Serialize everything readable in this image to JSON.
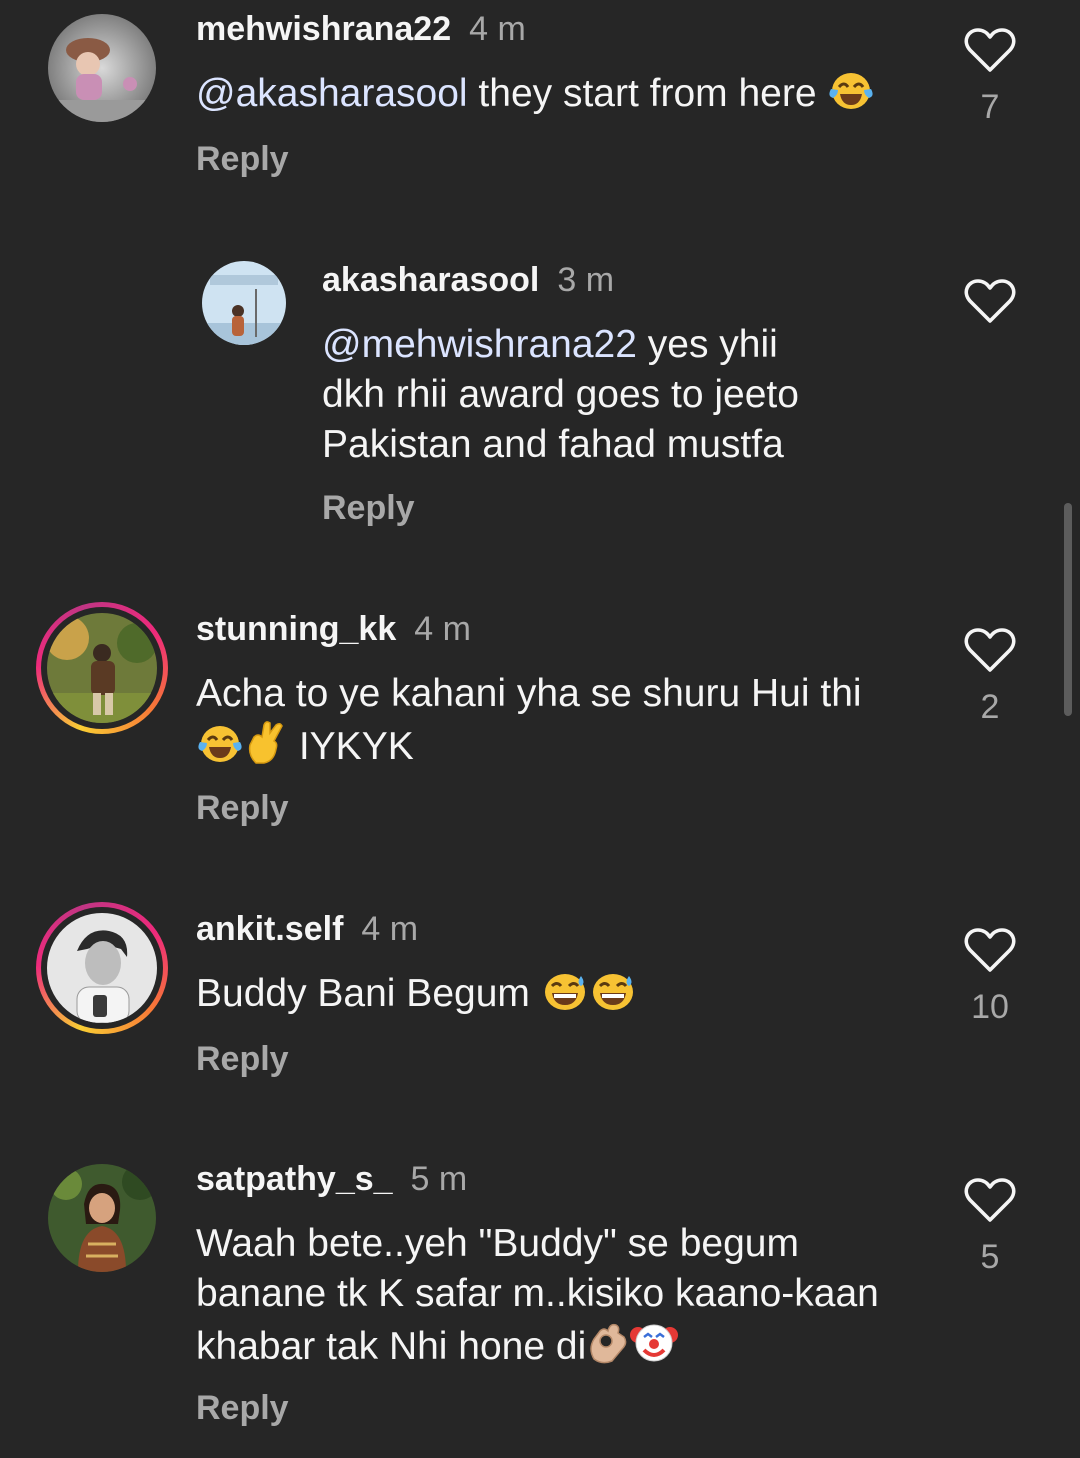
{
  "comments": [
    {
      "username": "mehwishrana22",
      "time": "4 m",
      "mention": "@akasharasool",
      "text": " they start from here ",
      "emojis": [
        "face-with-tears-of-joy"
      ],
      "reply_label": "Reply",
      "likes": "7"
    },
    {
      "username": "akasharasool",
      "time": "3 m",
      "mention": "@mehwishrana22",
      "text_line1": " yes yhii",
      "text_line2": "dkh rhii award goes to jeeto",
      "text_line3": "Pakistan and fahad mustfa",
      "reply_label": "Reply",
      "likes": ""
    },
    {
      "username": "stunning_kk",
      "time": "4 m",
      "text_line1": "Acha to ye kahani yha se shuru Hui thi",
      "text_line2": " IYKYK",
      "emojis": [
        "face-with-tears-of-joy",
        "crossed-fingers"
      ],
      "reply_label": "Reply",
      "likes": "2"
    },
    {
      "username": "ankit.self",
      "time": "4 m",
      "text": "Buddy Bani Begum ",
      "emojis": [
        "grinning-face-with-sweat",
        "grinning-face-with-sweat"
      ],
      "reply_label": "Reply",
      "likes": "10"
    },
    {
      "username": "satpathy_s_",
      "time": "5 m",
      "text_line1": "Waah bete..yeh \"Buddy\" se begum",
      "text_line2": "banane tk K safar m..kisiko kaano-kaan",
      "text_line3": "khabar tak Nhi hone di",
      "emojis": [
        "ok-hand",
        "clown-face"
      ],
      "reply_label": "Reply",
      "likes": "5"
    }
  ],
  "icons": {
    "like": "heart-outline-icon"
  },
  "colors": {
    "background": "#262626",
    "primary_text": "#f5f5f5",
    "secondary_text": "#a8a8a8",
    "mention": "#dbe4ff"
  }
}
